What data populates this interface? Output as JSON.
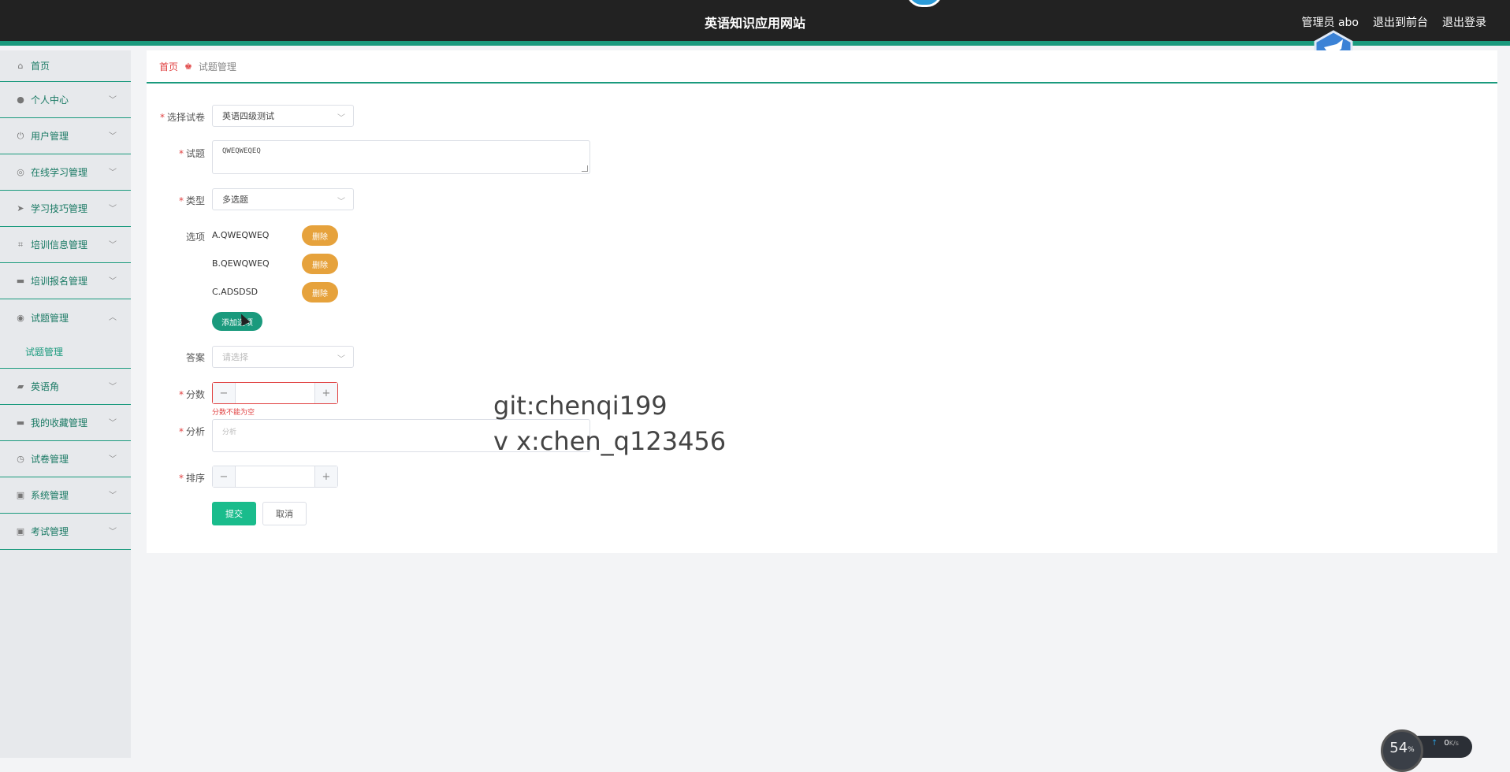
{
  "header": {
    "title": "英语知识应用网站",
    "links": [
      "管理员 abo",
      "退出到前台",
      "退出登录"
    ]
  },
  "sidebar": {
    "items": [
      {
        "label": "首页",
        "icon": "home-icon"
      },
      {
        "label": "个人中心",
        "icon": "user-icon"
      },
      {
        "label": "用户管理",
        "icon": "power-icon"
      },
      {
        "label": "在线学习管理",
        "icon": "compass-icon"
      },
      {
        "label": "学习技巧管理",
        "icon": "send-icon"
      },
      {
        "label": "培训信息管理",
        "icon": "crop-icon"
      },
      {
        "label": "培训报名管理",
        "icon": "message-icon"
      },
      {
        "label": "试题管理",
        "icon": "target-icon",
        "expanded": true
      },
      {
        "label": "试题管理",
        "sub": true
      },
      {
        "label": "英语角",
        "icon": "briefcase-icon"
      },
      {
        "label": "我的收藏管理",
        "icon": "folder-icon"
      },
      {
        "label": "试卷管理",
        "icon": "clock-icon"
      },
      {
        "label": "系统管理",
        "icon": "clipboard-icon"
      },
      {
        "label": "考试管理",
        "icon": "check-icon"
      }
    ]
  },
  "breadcrumb": {
    "home": "首页",
    "current": "试题管理"
  },
  "form": {
    "paper_label": "选择试卷",
    "paper_value": "英语四级测试",
    "question_label": "试题",
    "question_value": "QWEQWEQEQ",
    "type_label": "类型",
    "type_value": "多选题",
    "options_label": "选项",
    "options": [
      "A.QWEQWEQ",
      "B.QEWQWEQ",
      "C.ADSDSD"
    ],
    "delete_label": "删除",
    "add_option_label": "添加选项",
    "answer_label": "答案",
    "answer_placeholder": "请选择",
    "score_label": "分数",
    "score_error": "分数不能为空",
    "analysis_label": "分析",
    "analysis_placeholder": "分析",
    "sort_label": "排序",
    "submit_label": "提交",
    "cancel_label": "取消"
  },
  "watermark": [
    "git:chenqi199",
    "v x:chen_q123456"
  ],
  "speed_widget": {
    "percent": "54",
    "unit": "%",
    "rate": "0",
    "rate_unit": "K/s"
  },
  "colors": {
    "accent": "#1a9a7d",
    "header_bg": "#222222",
    "danger": "#e04040",
    "warning": "#e6a23c",
    "primary": "#1abc8c"
  }
}
